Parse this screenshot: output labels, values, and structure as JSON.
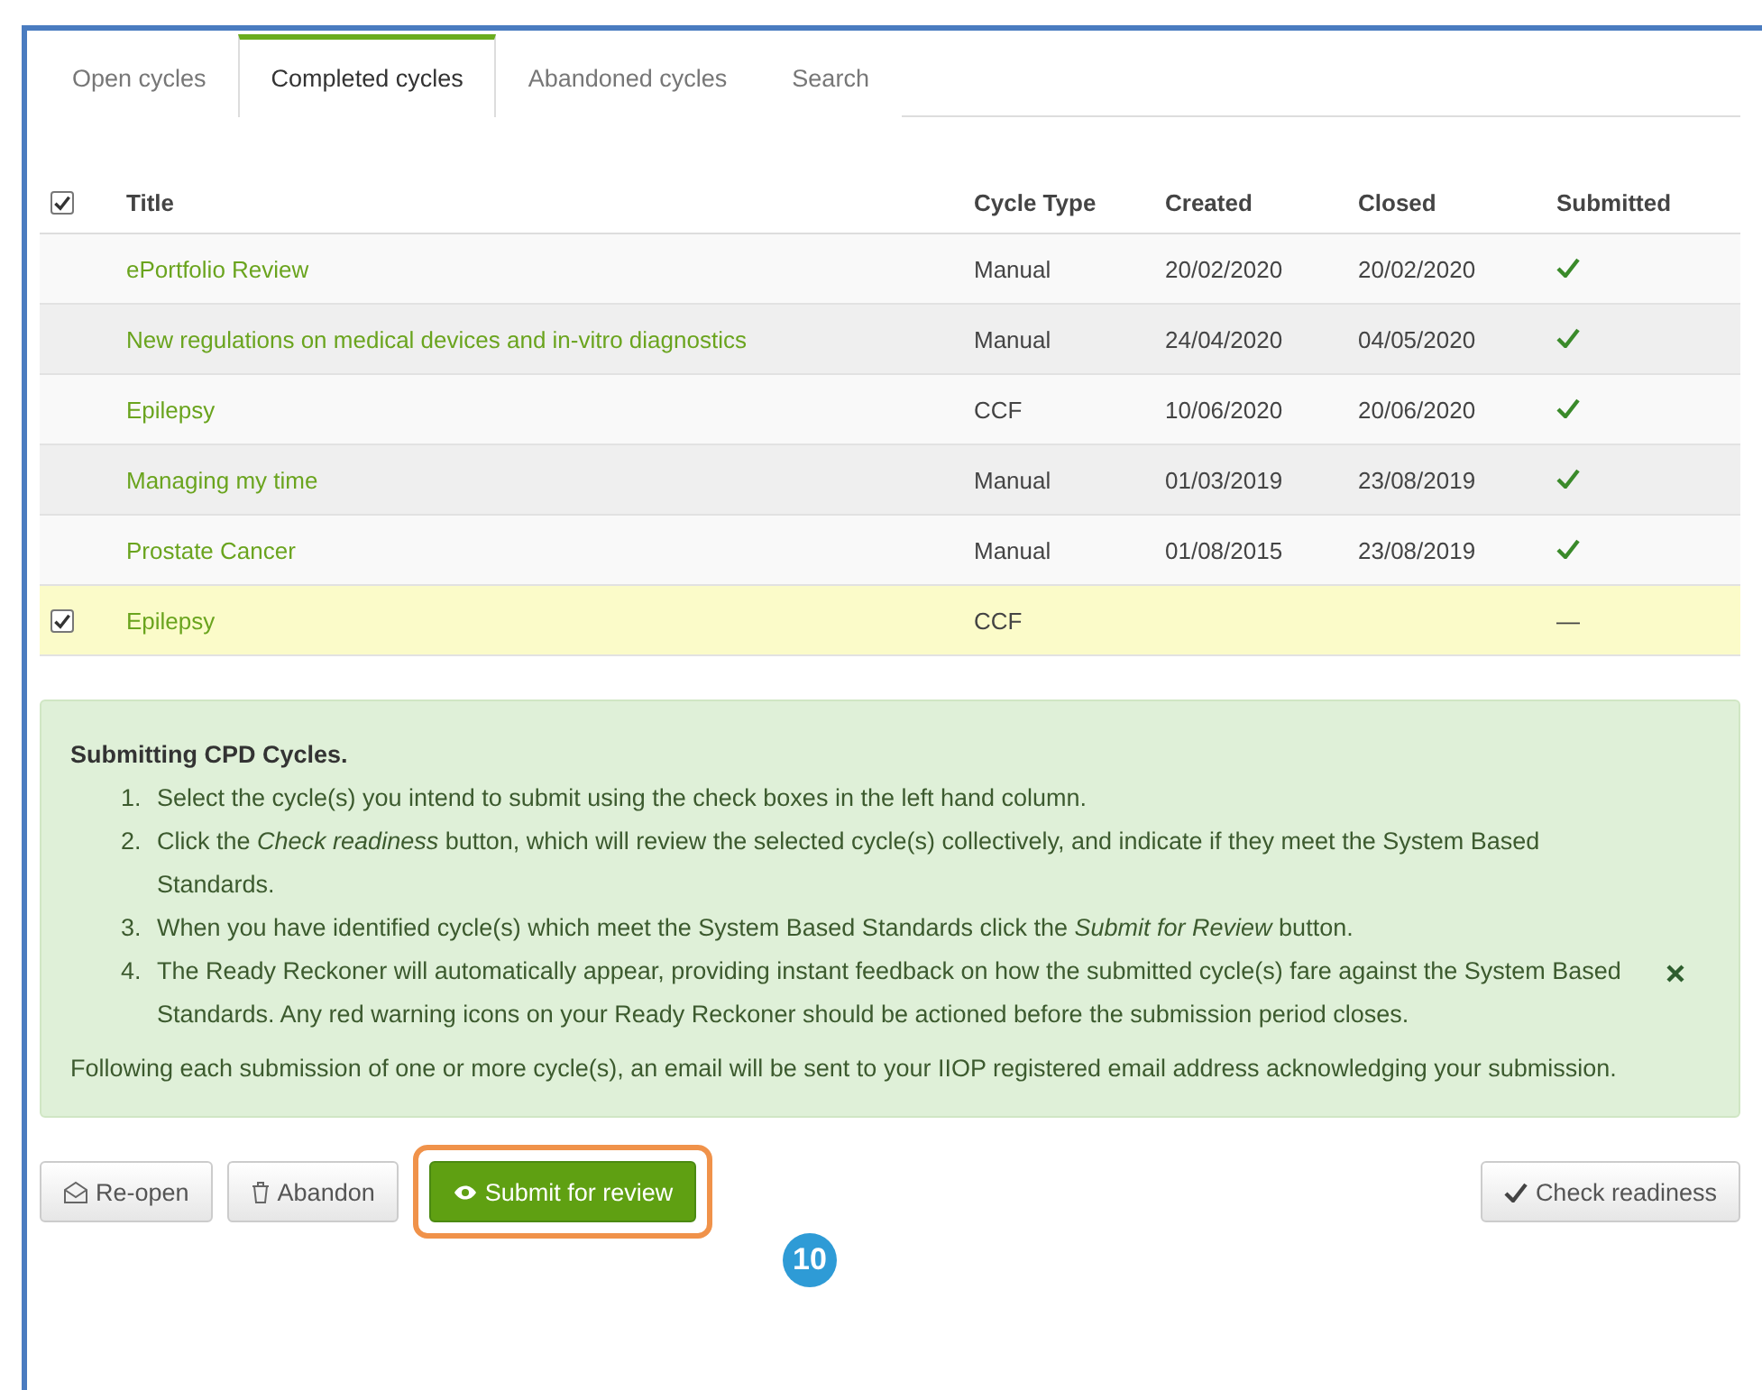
{
  "tabs": [
    {
      "label": "Open cycles",
      "selected": false
    },
    {
      "label": "Completed cycles",
      "selected": true
    },
    {
      "label": "Abandoned cycles",
      "selected": false
    },
    {
      "label": "Search",
      "selected": false
    }
  ],
  "table": {
    "select_all_checked": true,
    "columns": [
      "Title",
      "Cycle Type",
      "Created",
      "Closed",
      "Submitted"
    ],
    "rows": [
      {
        "checked": false,
        "title": "ePortfolio Review",
        "cycle_type": "Manual",
        "created": "20/02/2020",
        "closed": "20/02/2020",
        "submitted": true
      },
      {
        "checked": false,
        "title": "New regulations on medical devices and in-vitro diagnostics",
        "cycle_type": "Manual",
        "created": "24/04/2020",
        "closed": "04/05/2020",
        "submitted": true
      },
      {
        "checked": false,
        "title": "Epilepsy",
        "cycle_type": "CCF",
        "created": "10/06/2020",
        "closed": "20/06/2020",
        "submitted": true
      },
      {
        "checked": false,
        "title": "Managing my time",
        "cycle_type": "Manual",
        "created": "01/03/2019",
        "closed": "23/08/2019",
        "submitted": true
      },
      {
        "checked": false,
        "title": "Prostate Cancer",
        "cycle_type": "Manual",
        "created": "01/08/2015",
        "closed": "23/08/2019",
        "submitted": true
      },
      {
        "checked": true,
        "title": "Epilepsy",
        "cycle_type": "CCF",
        "submitted": false,
        "dash": "—"
      }
    ]
  },
  "info": {
    "heading": "Submitting CPD Cycles.",
    "steps": [
      {
        "number": "1.",
        "text": "Select the cycle(s) you intend to submit using the check boxes in the left hand column."
      },
      {
        "number": "2.",
        "text": "Click the *Check readiness* button, which will review the selected cycle(s) collectively, and indicate if they meet the System Based Standards."
      },
      {
        "number": "3.",
        "text": "When you have identified cycle(s) which meet the System Based Standards click the *Submit for Review* button."
      },
      {
        "number": "4.",
        "text": "The Ready Reckoner will automatically appear, providing instant feedback on how the submitted cycle(s) fare against the System Based Standards. Any red warning icons on your Ready Reckoner should be actioned before the submission period closes."
      }
    ],
    "footer": "Following each submission of one or more cycle(s), an email will be sent to your IIOP registered email address acknowledging your submission."
  },
  "buttons": [
    {
      "kind": "reopen",
      "label": "Re-open"
    },
    {
      "kind": "abandon",
      "label": "Abandon"
    },
    {
      "kind": "submit",
      "label": "Submit for review",
      "highlighted": true
    },
    {
      "kind": "check",
      "label": "Check readiness"
    }
  ],
  "callout": "10"
}
